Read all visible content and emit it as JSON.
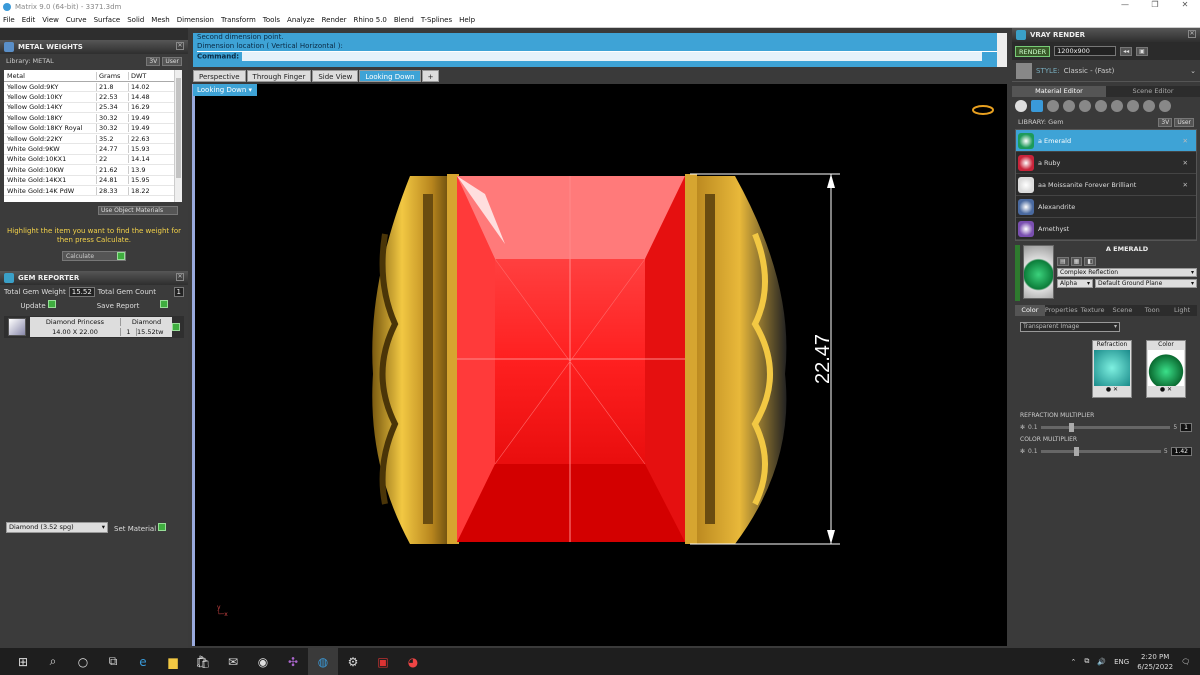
{
  "window": {
    "title": "Matrix 9.0 (64-bit) - 3371.3dm"
  },
  "menu": [
    "File",
    "Edit",
    "View",
    "Curve",
    "Surface",
    "Solid",
    "Mesh",
    "Dimension",
    "Transform",
    "Tools",
    "Analyze",
    "Render",
    "Rhino 5.0",
    "Blend",
    "T-Splines",
    "Help"
  ],
  "metal_weights": {
    "title": "METAL WEIGHTS",
    "library_label": "Library: METAL",
    "btn_3v": "3V",
    "btn_user": "User",
    "columns": [
      "Metal",
      "Grams",
      "DWT"
    ],
    "rows": [
      [
        "Yellow Gold:9KY",
        "21.8",
        "14.02"
      ],
      [
        "Yellow Gold:10KY",
        "22.53",
        "14.48"
      ],
      [
        "Yellow Gold:14KY",
        "25.34",
        "16.29"
      ],
      [
        "Yellow Gold:18KY",
        "30.32",
        "19.49"
      ],
      [
        "Yellow Gold:18KY Royal",
        "30.32",
        "19.49"
      ],
      [
        "Yellow Gold:22KY",
        "35.2",
        "22.63"
      ],
      [
        "White Gold:9KW",
        "24.77",
        "15.93"
      ],
      [
        "White Gold:10KX1",
        "22",
        "14.14"
      ],
      [
        "White Gold:10KW",
        "21.62",
        "13.9"
      ],
      [
        "White Gold:14KX1",
        "24.81",
        "15.95"
      ],
      [
        "White Gold:14K PdW",
        "28.33",
        "18.22"
      ]
    ],
    "use_object_materials": "Use Object Materials",
    "hint": "Highlight the item you want to find the weight for then press Calculate.",
    "calculate": "Calculate"
  },
  "gem_reporter": {
    "title": "GEM REPORTER",
    "total_weight_label": "Total Gem Weight",
    "total_weight": "15.52",
    "total_count_label": "Total Gem Count",
    "total_count": "1",
    "update": "Update",
    "save_report": "Save Report",
    "gem": {
      "name": "Diamond Princess",
      "size": "14.00 X 22.00",
      "type": "Diamond",
      "count": "1",
      "weight": "15.52tw"
    }
  },
  "material_select": {
    "value": "Diamond    (3.52 spg)",
    "set_label": "Set Material"
  },
  "command": {
    "line1": "Second dimension point.",
    "line2": "Dimension location ( Vertical  Horizontal ):",
    "prompt": "Command:"
  },
  "tabs": [
    "Perspective",
    "Through Finger",
    "Side View",
    "Looking Down",
    "+"
  ],
  "active_view": "Looking Down",
  "dimension_value": "22.47",
  "vray": {
    "title": "VRAY RENDER",
    "render_label": "RENDER",
    "resolution": "1200x900",
    "style_label": "STYLE:",
    "style_value": "Classic - (Fast)",
    "editor_tabs": [
      "Material Editor",
      "Scene Editor"
    ],
    "library_label": "LIBRARY: Gem",
    "materials": [
      {
        "name": "a Emerald",
        "color": "#1d9a5a"
      },
      {
        "name": "a Ruby",
        "color": "#c8243a"
      },
      {
        "name": "aa Moissanite Forever Brilliant",
        "color": "#dcdcdc"
      },
      {
        "name": "Alexandrite",
        "color": "#4a6aa0"
      },
      {
        "name": "Amethyst",
        "color": "#7a4fb0"
      }
    ],
    "selected_material": "A EMERALD",
    "reflection": "Complex Reflection",
    "alpha": "Alpha",
    "ground": "Default Ground Plane",
    "color_tabs": [
      "Color",
      "Properties",
      "Texture",
      "Scene",
      "Toon",
      "Light"
    ],
    "transparent": "Transparent Image",
    "refraction_label": "Refraction",
    "color_label": "Color",
    "refraction_mult_label": "REFRACTION MULTIPLIER",
    "refraction_min": "0.1",
    "refraction_max": "5",
    "refraction_value": "1",
    "color_mult_label": "COLOR MULTIPLIER",
    "color_min": "0.1",
    "color_max": "5",
    "color_value": "1.42"
  },
  "taskbar": {
    "lang": "ENG",
    "time": "2:20 PM",
    "date": "6/25/2022"
  }
}
